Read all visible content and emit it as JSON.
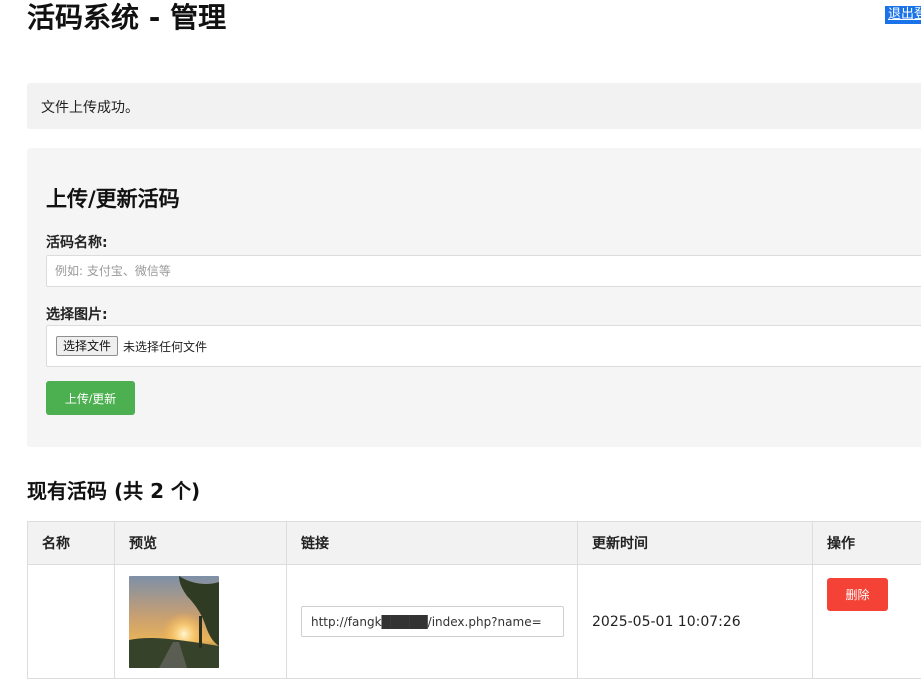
{
  "header": {
    "title": "活码系统 - 管理",
    "logout_label": "退出登录"
  },
  "flash": {
    "message": "文件上传成功。"
  },
  "form": {
    "title": "上传/更新活码",
    "name_label": "活码名称:",
    "name_placeholder": "例如: 支付宝、微信等",
    "file_label": "选择图片:",
    "file_button_label": "选择文件",
    "file_status": "未选择任何文件",
    "submit_label": "上传/更新"
  },
  "list": {
    "title": "现有活码 (共 2 个)",
    "columns": {
      "name": "名称",
      "preview": "预览",
      "link": "链接",
      "updated": "更新时间",
      "actions": "操作"
    },
    "rows": [
      {
        "name": "",
        "link": "http://fangk█████/index.php?name=",
        "updated": "2025-05-01 10:07:26",
        "delete_label": "删除"
      }
    ]
  }
}
